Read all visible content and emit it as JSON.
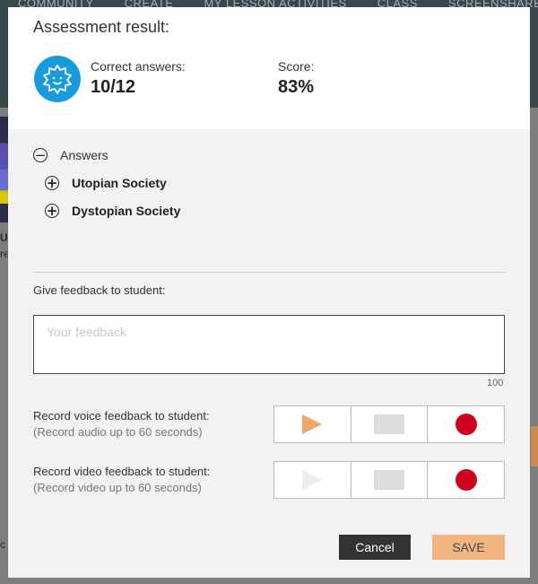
{
  "background": {
    "nav_items": [
      "COMMUNITY",
      "CREATE",
      "MY LESSON ACTIVITIES",
      "CLASS",
      "SCREENSHARE"
    ],
    "side_text": [
      "U",
      "re",
      "c"
    ]
  },
  "modal": {
    "title": "Assessment result:",
    "result_icon": "gear-face-icon",
    "correct_label": "Correct answers:",
    "correct_value": "10/12",
    "score_label": "Score:",
    "score_value": "83%",
    "answers": {
      "label": "Answers",
      "items": [
        "Utopian Society",
        "Dystopian Society"
      ]
    },
    "feedback": {
      "label": "Give feedback to student:",
      "placeholder": "Your feedback",
      "value": "",
      "max_chars": "100"
    },
    "voice": {
      "label": "Record voice feedback to student:",
      "sublabel": "(Record audio up to 60 seconds)"
    },
    "video": {
      "label": "Record video feedback to student:",
      "sublabel": "(Record video up to 60 seconds)"
    },
    "buttons": {
      "cancel": "Cancel",
      "save": "SAVE"
    },
    "colors": {
      "accent": "#1a9be0",
      "save": "#f2b57f",
      "record": "#d0021b",
      "play": "#f0a866"
    }
  }
}
